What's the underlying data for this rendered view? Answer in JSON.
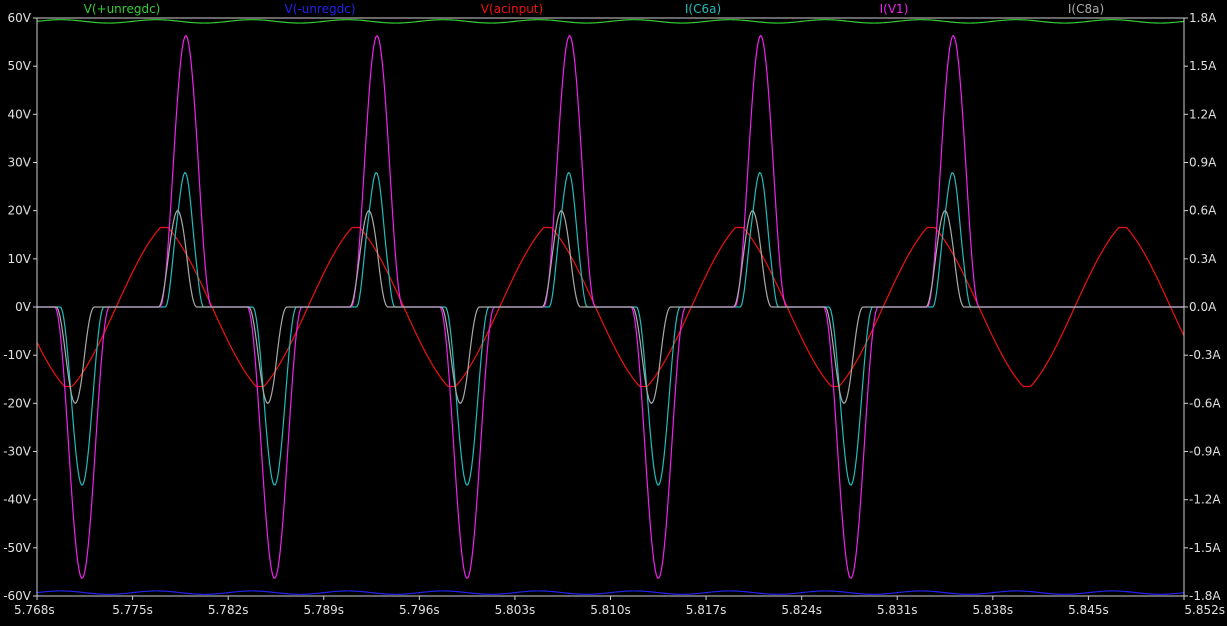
{
  "chart_data": {
    "type": "line",
    "title": "",
    "xlabel": "",
    "ylabel": "",
    "xlim": [
      5.768,
      5.852
    ],
    "ylim": [
      -60,
      60
    ],
    "y2lim": [
      -1.8,
      1.8
    ],
    "grid": false,
    "legend_placement": "top",
    "x_tick_labels": [
      "5.768s",
      "5.775s",
      "5.782s",
      "5.789s",
      "5.796s",
      "5.803s",
      "5.810s",
      "5.817s",
      "5.824s",
      "5.831s",
      "5.838s",
      "5.845s",
      "5.852s"
    ],
    "y_tick_labels": [
      "60V",
      "50V",
      "40V",
      "30V",
      "20V",
      "10V",
      "0V",
      "-10V",
      "-20V",
      "-30V",
      "-40V",
      "-50V",
      "-60V"
    ],
    "y2_tick_labels": [
      "1.8A",
      "1.5A",
      "1.2A",
      "0.9A",
      "0.6A",
      "0.3A",
      "0.0A",
      "-0.3A",
      "-0.6A",
      "-0.9A",
      "-1.2A",
      "-1.5A",
      "-1.8A"
    ],
    "series": [
      {
        "name": "V(+unregdc)",
        "color": "#33cc33",
        "axis": "left",
        "shape": "rail",
        "level": 59.3
      },
      {
        "name": "V(-unregdc)",
        "color": "#2222ee",
        "axis": "left",
        "shape": "rail",
        "level": -59.3
      },
      {
        "name": "V(acinput)",
        "color": "#ee1111",
        "axis": "left",
        "shape": "sine",
        "amplitude": 16.5,
        "period": 0.01404,
        "phase_x": 5.7738
      },
      {
        "name": "I(C6a)",
        "color": "#22bbbb",
        "axis": "right",
        "shape": "pulses",
        "pos_peak": 0.93,
        "neg_peak": -1.11
      },
      {
        "name": "I(V1)",
        "color": "#ee22ee",
        "axis": "right",
        "shape": "pulses",
        "pos_peak": 1.69,
        "neg_peak": -1.69
      },
      {
        "name": "I(C8a)",
        "color": "#aaaaaa",
        "axis": "right",
        "shape": "pulses",
        "pos_peak": 0.6,
        "neg_peak": -0.6
      }
    ],
    "pulse_centers_pos": [
      5.7789,
      5.7929,
      5.807,
      5.821,
      5.8351
    ],
    "pulse_centers_neg": [
      5.7713,
      5.7854,
      5.7995,
      5.8135,
      5.8276
    ]
  }
}
